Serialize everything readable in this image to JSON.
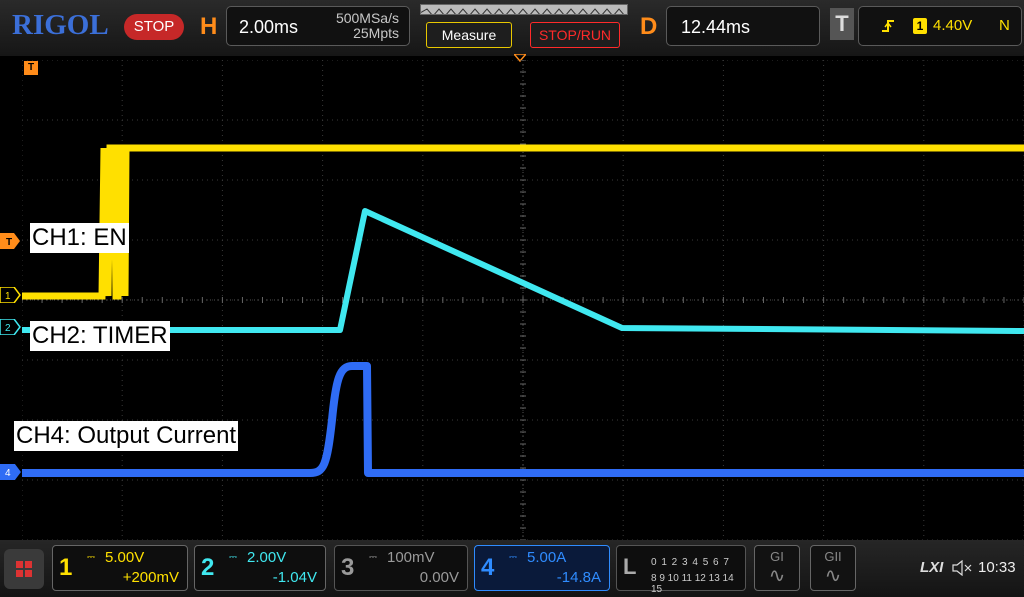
{
  "brand": "RIGOL",
  "run_state": "STOP",
  "horizontal": {
    "letter": "H",
    "timebase": "2.00ms",
    "sample_rate": "500MSa/s",
    "memory_depth": "25Mpts"
  },
  "buttons": {
    "measure": "Measure",
    "stop_run": "STOP/RUN"
  },
  "delay": {
    "letter": "D",
    "value": "12.44ms"
  },
  "trigger": {
    "letter": "T",
    "edge_icon": "rising-edge-icon",
    "source": "1",
    "level": "4.40V",
    "mode": "N",
    "marker": "T"
  },
  "waveforms": {
    "ch1": {
      "label": "CH1: EN",
      "marker": "1",
      "color": "#ffe000"
    },
    "ch2": {
      "label": "CH2: TIMER",
      "marker": "2",
      "color": "#40e8f0"
    },
    "ch4": {
      "label": "CH4: Output Current",
      "marker": "4",
      "color": "#2f6cf5"
    },
    "trigger_marker_color": "#ff8c1a"
  },
  "channels": [
    {
      "num": "1",
      "coupling": "DC",
      "scale": "5.00V",
      "offset": "+200mV",
      "color": "#ffe000",
      "active": true
    },
    {
      "num": "2",
      "coupling": "DC",
      "scale": "2.00V",
      "offset": "-1.04V",
      "color": "#40e8f0",
      "active": true
    },
    {
      "num": "3",
      "coupling": "DC",
      "scale": "100mV",
      "offset": "0.00V",
      "color": "#9a9a9a",
      "active": false
    },
    {
      "num": "4",
      "coupling": "DC",
      "scale": "5.00A",
      "offset": "-14.8A",
      "color": "#2f8cff",
      "active": true
    }
  ],
  "logic": {
    "letter": "L",
    "row1": "0 1 2 3  4 5 6 7",
    "row2": "8 9 10 11 12 13 14 15"
  },
  "generators": [
    {
      "label": "GI"
    },
    {
      "label": "GII"
    }
  ],
  "status": {
    "lxi": "LXI",
    "volume_icon": "speaker-muted-icon",
    "time": "10:33"
  }
}
